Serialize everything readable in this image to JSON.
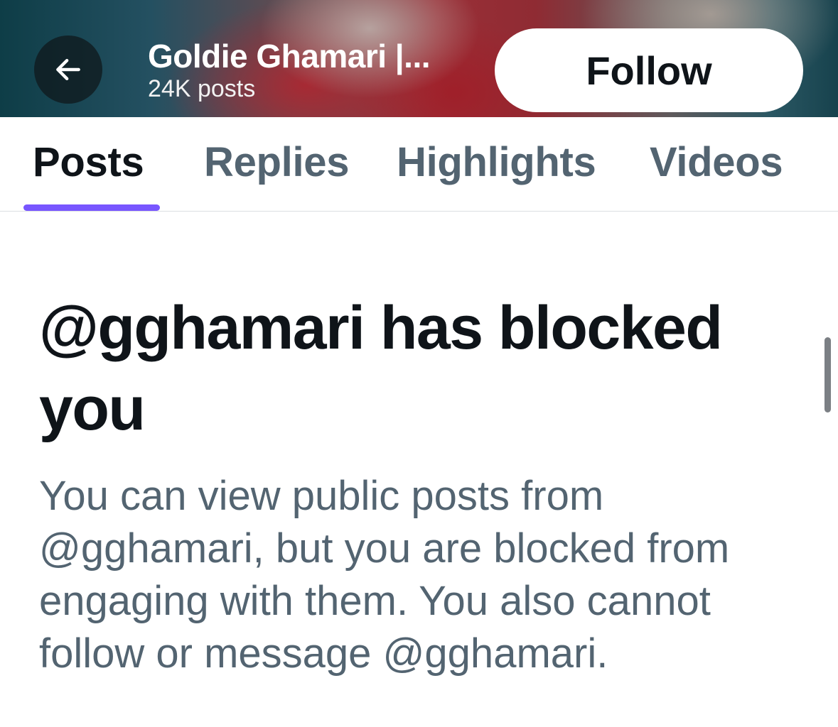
{
  "header": {
    "back_icon": "arrow-left-icon",
    "profile_name": "Goldie Ghamari |...",
    "post_count": "24K posts",
    "follow_label": "Follow"
  },
  "tabs": [
    {
      "label": "Posts",
      "active": true
    },
    {
      "label": "Replies",
      "active": false
    },
    {
      "label": "Highlights",
      "active": false
    },
    {
      "label": "Videos",
      "active": false
    }
  ],
  "blocked": {
    "title": "@gghamari has blocked you",
    "body": "You can view public posts from @gghamari, but you are blocked from engaging with them. You also cannot follow or message @gghamari."
  },
  "colors": {
    "tab_indicator": "#7856ff",
    "primary_text": "#0f1419",
    "secondary_text": "#536471"
  }
}
